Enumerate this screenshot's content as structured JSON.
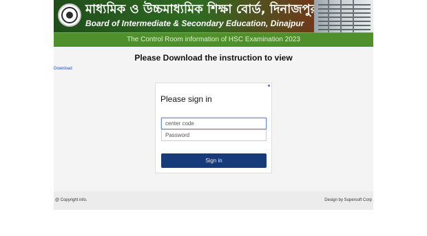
{
  "header": {
    "title_bn": "মাধ্যমিক ও উচ্চমাধ্যমিক শিক্ষা বোর্ড, দিনাজপুর",
    "title_en": "Board of Intermediate & Secondary Education, Dinajpur",
    "subtitle": "The Control Room information of HSC Examination 2023",
    "logo_icon": "board-emblem-icon"
  },
  "main": {
    "heading": "Please Download the instruction to view",
    "download_link": "Download"
  },
  "signin": {
    "title": "Please sign in",
    "center_code_placeholder": "center code",
    "password_placeholder": "Password",
    "button_label": "Sign in"
  },
  "footer": {
    "copyright": "@ Copyright info.",
    "design": "Design by Supersoft Corp"
  },
  "colors": {
    "banner_green": "#2f6a22",
    "subbar_green": "#4f8f2c",
    "button_navy": "#163a7a",
    "link_blue": "#1a4fb5"
  }
}
